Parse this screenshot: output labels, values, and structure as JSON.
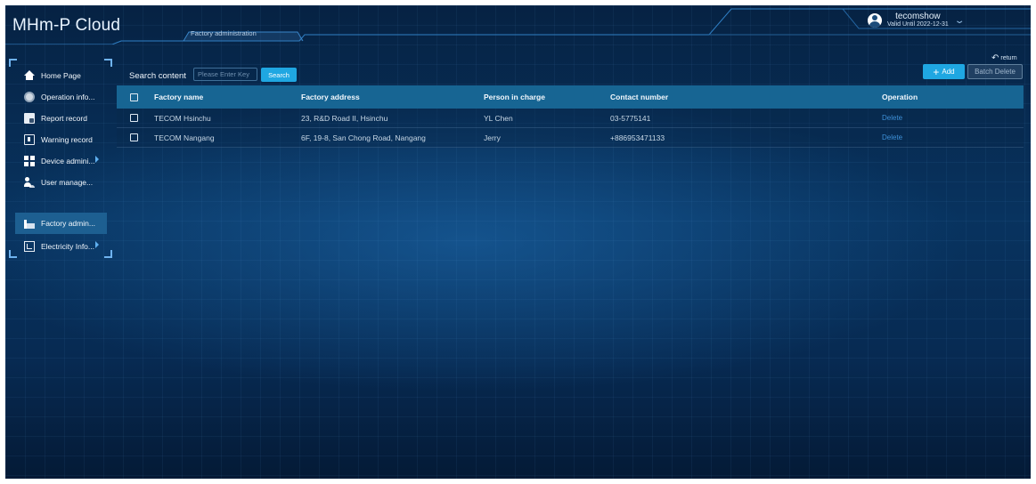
{
  "header": {
    "app_title": "MHm-P Cloud",
    "active_tab": "Factory administration",
    "user": {
      "name": "tecomshow",
      "valid_until": "Valid Until 2022-12-31",
      "dropdown_icon": "chevron-down-icon"
    }
  },
  "sidebar": {
    "items": [
      {
        "label": "Home Page",
        "icon": "home-icon",
        "active": false,
        "has_submenu": false
      },
      {
        "label": "Operation info...",
        "icon": "operation-icon",
        "active": false,
        "has_submenu": false
      },
      {
        "label": "Report record",
        "icon": "report-icon",
        "active": false,
        "has_submenu": false
      },
      {
        "label": "Warning record",
        "icon": "warning-icon",
        "active": false,
        "has_submenu": false
      },
      {
        "label": "Device admini...",
        "icon": "device-icon",
        "active": false,
        "has_submenu": true
      },
      {
        "label": "User manage...",
        "icon": "user-icon",
        "active": false,
        "has_submenu": false
      },
      {
        "label": "Factory admin...",
        "icon": "factory-icon",
        "active": true,
        "has_submenu": false
      },
      {
        "label": "Electricity Info...",
        "icon": "electricity-icon",
        "active": false,
        "has_submenu": true
      }
    ]
  },
  "toolbar": {
    "search_label": "Search content",
    "search_placeholder": "Please Enter Key",
    "search_value": "",
    "search_button": "Search",
    "return_label": "return",
    "add_button": "Add",
    "batch_delete_button": "Batch Delete"
  },
  "table": {
    "columns": [
      "Factory name",
      "Factory address",
      "Person in charge",
      "Contact number",
      "Operation"
    ],
    "rows": [
      {
        "name": "TECOM Hsinchu",
        "address": "23, R&D Road II, Hsinchu",
        "person": "YL Chen",
        "contact": "03-5775141",
        "operation": "Delete"
      },
      {
        "name": "TECOM Nangang",
        "address": "6F, 19-8, San Chong Road, Nangang",
        "person": "Jerry",
        "contact": "+886953471133",
        "operation": "Delete"
      }
    ]
  },
  "colors": {
    "accent": "#1fa7e2",
    "table_header": "#176593",
    "active_menu": "#1d5f91",
    "link": "#3d8fd6"
  }
}
